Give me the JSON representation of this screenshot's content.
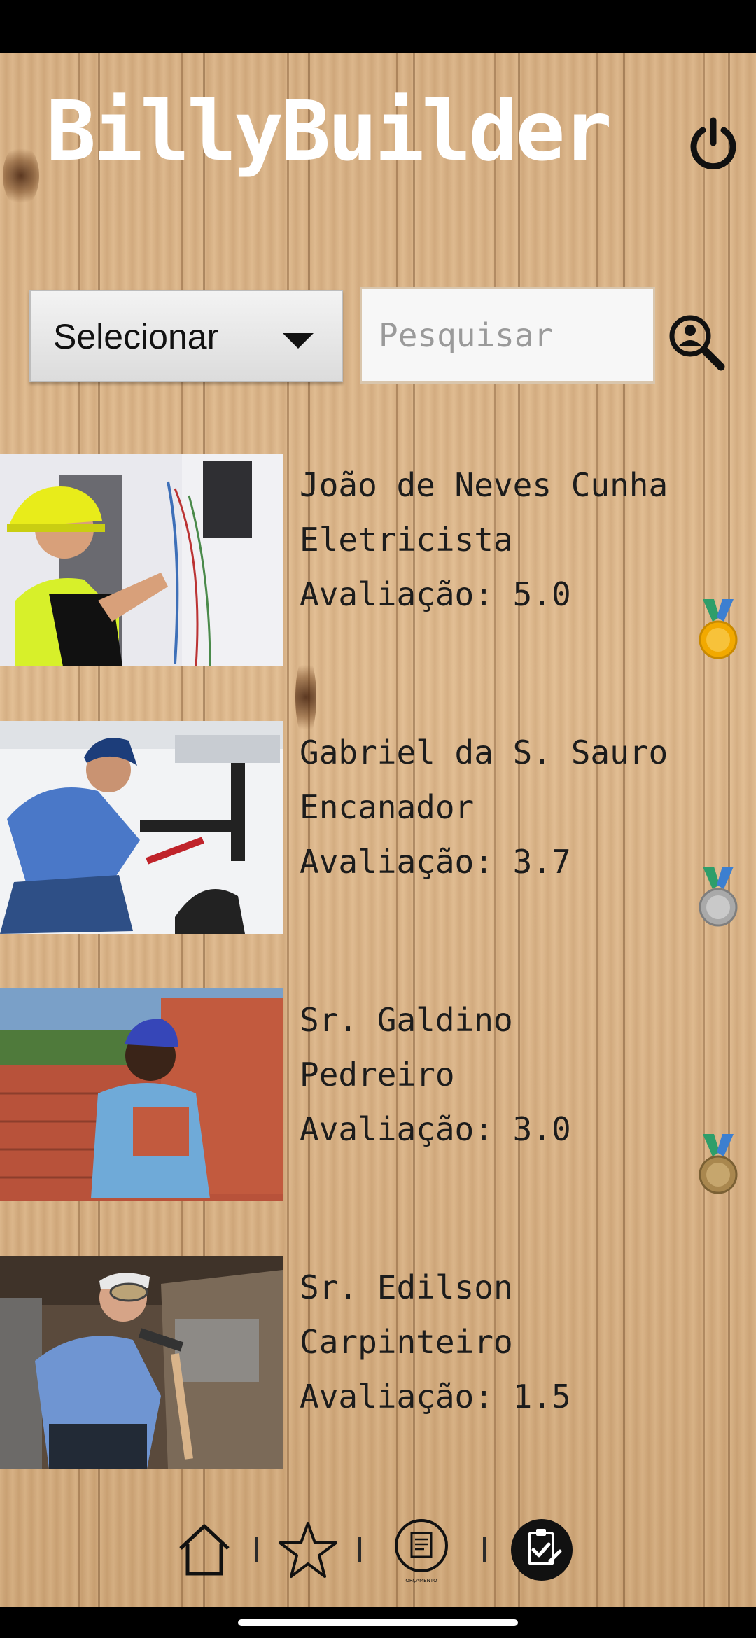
{
  "app": {
    "title": "BillyBuilder"
  },
  "filters": {
    "select_label": "Selecionar",
    "search_placeholder": "Pesquisar"
  },
  "professionals": [
    {
      "name": "João de Neves Cunha",
      "role": "Eletricista",
      "rating": "Avaliação: 5.0",
      "medal": "gold-medal-icon",
      "medal_color": "#f2a900"
    },
    {
      "name": "Gabriel da S. Sauro",
      "role": "Encanador",
      "rating": "Avaliação: 3.7",
      "medal": "silver-medal-icon",
      "medal_color": "#a9a9a9"
    },
    {
      "name": "Sr. Galdino",
      "role": "Pedreiro",
      "rating": "Avaliação: 3.0",
      "medal": "bronze-medal-icon",
      "medal_color": "#a9874e"
    },
    {
      "name": "Sr. Edilson",
      "role": "Carpinteiro",
      "rating": "Avaliação: 1.5",
      "medal": "none"
    }
  ],
  "bottom_nav": {
    "items": [
      "home-icon",
      "star-icon",
      "orcamento-icon",
      "clipboard-check-icon"
    ],
    "orcamento_caption": "ORÇAMENTO"
  },
  "colors": {
    "wood": "#d9b286",
    "title": "#ffffff",
    "text": "#1c1c1c"
  }
}
